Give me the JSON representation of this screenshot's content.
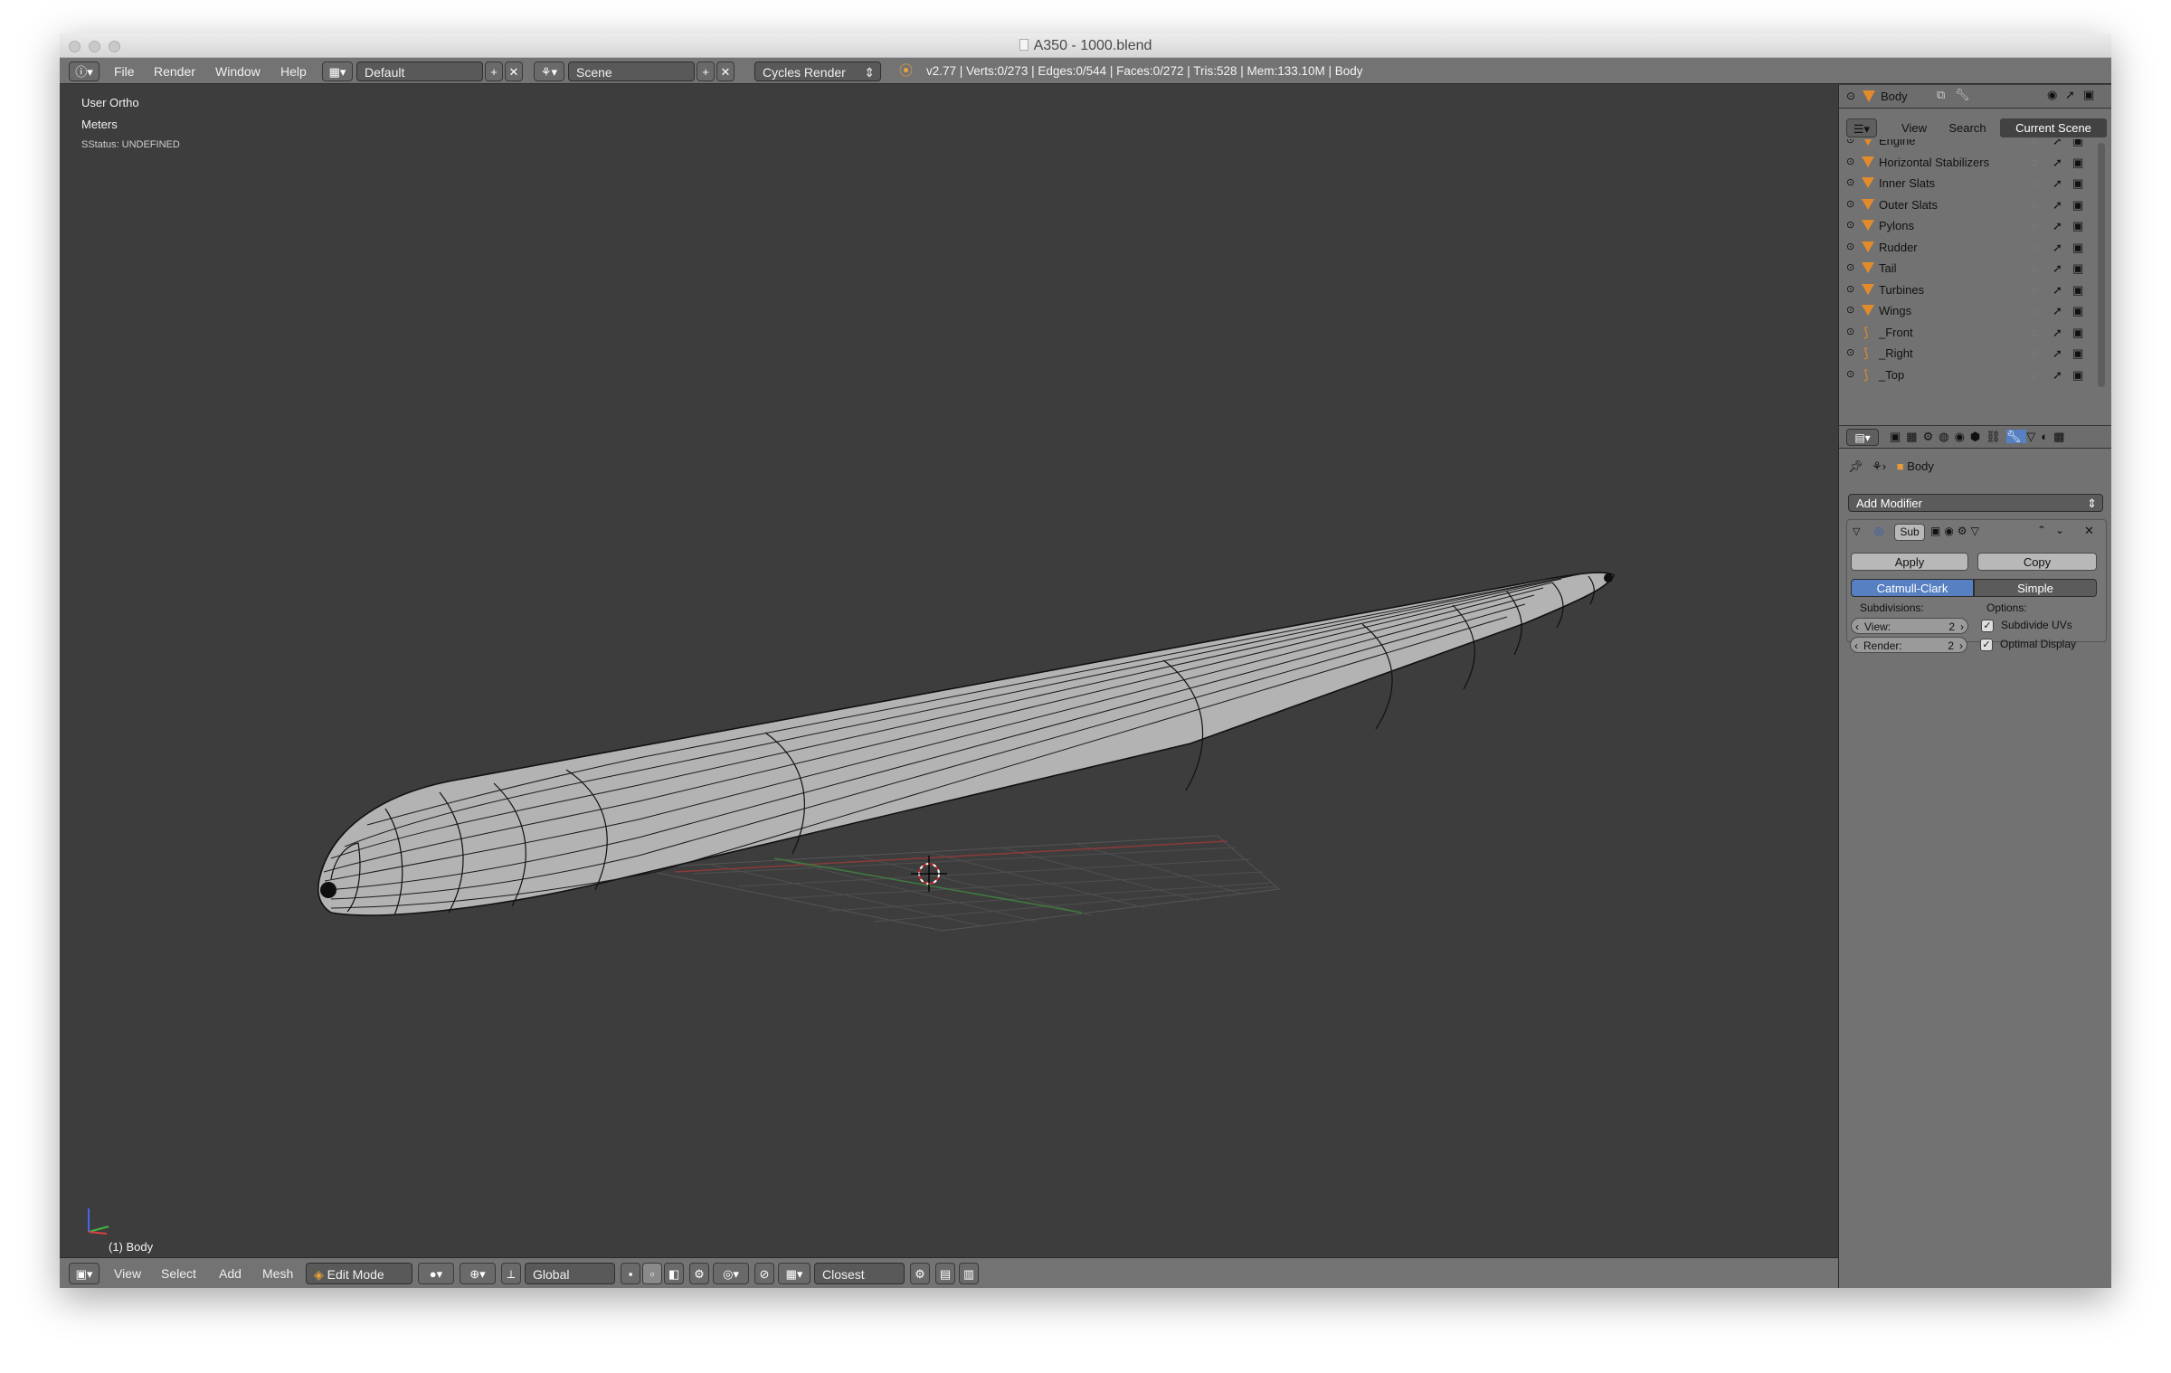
{
  "window": {
    "title": "A350 - 1000.blend"
  },
  "info_bar": {
    "menus": [
      "File",
      "Render",
      "Window",
      "Help"
    ],
    "screen_layout": "Default",
    "scene": "Scene",
    "render_engine": "Cycles Render",
    "stats": "v2.77 | Verts:0/273 | Edges:0/544 | Faces:0/272 | Tris:528 | Mem:133.10M | Body"
  },
  "viewport": {
    "view_name": "User Ortho",
    "units": "Meters",
    "status": "SStatus: UNDEFINED",
    "object_label": "(1) Body",
    "axis_colors": {
      "x": "#d64040",
      "y": "#3fb83f",
      "z": "#4466ee"
    },
    "grid_colors": {
      "grid": "#505050",
      "x_axis": "#8a3a3a",
      "y_axis": "#3f7a3f"
    }
  },
  "footer": {
    "menus": [
      "View",
      "Select",
      "Add",
      "Mesh"
    ],
    "mode": "Edit Mode",
    "orientation": "Global",
    "snap_target": "Closest"
  },
  "outliner": {
    "header_object": "Body",
    "tabs": [
      "View",
      "Search",
      "Current Scene"
    ],
    "active_tab": "Current Scene",
    "items": [
      {
        "name": "Engine",
        "icon": "mesh-icon"
      },
      {
        "name": "Horizontal Stabilizers",
        "icon": "mesh-icon"
      },
      {
        "name": "Inner Slats",
        "icon": "mesh-icon"
      },
      {
        "name": "Outer Slats",
        "icon": "mesh-icon"
      },
      {
        "name": "Pylons",
        "icon": "mesh-icon"
      },
      {
        "name": "Rudder",
        "icon": "mesh-icon"
      },
      {
        "name": "Tail",
        "icon": "mesh-icon"
      },
      {
        "name": "Turbines",
        "icon": "mesh-icon"
      },
      {
        "name": "Wings",
        "icon": "mesh-icon"
      },
      {
        "name": "_Front",
        "icon": "empty-icon"
      },
      {
        "name": "_Right",
        "icon": "empty-icon"
      },
      {
        "name": "_Top",
        "icon": "empty-icon"
      }
    ]
  },
  "properties": {
    "breadcrumb_object": "Body",
    "add_modifier": "Add Modifier",
    "modifier": {
      "name": "Sub",
      "apply": "Apply",
      "copy": "Copy",
      "type_options": [
        "Catmull-Clark",
        "Simple"
      ],
      "selected_type": "Catmull-Clark",
      "subdivisions_label": "Subdivisions:",
      "options_label": "Options:",
      "view_label": "View:",
      "view_value": "2",
      "render_label": "Render:",
      "render_value": "2",
      "subdivide_uvs": "Subdivide UVs",
      "optimal_display": "Optimal Display"
    }
  }
}
